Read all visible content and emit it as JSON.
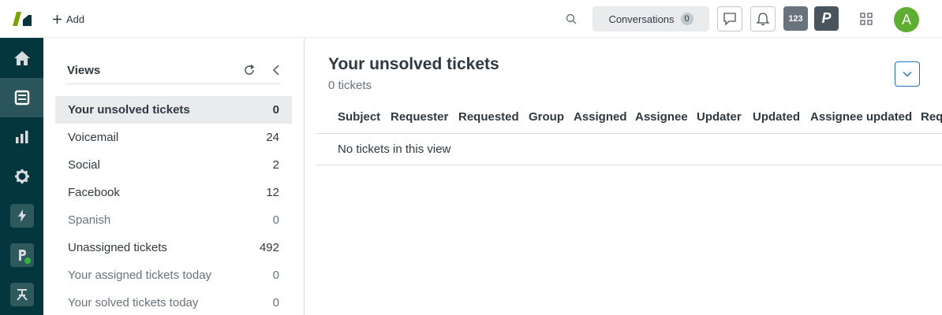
{
  "nav": {
    "items": [
      {
        "name": "home-icon",
        "active": false
      },
      {
        "name": "views-icon",
        "active": true
      },
      {
        "name": "reporting-icon",
        "active": false
      },
      {
        "name": "admin-gear-icon",
        "active": false
      },
      {
        "name": "lightning-icon",
        "active": false
      },
      {
        "name": "app-p-icon",
        "active": false
      },
      {
        "name": "app-figure-icon",
        "active": false
      }
    ]
  },
  "topbar": {
    "add_label": "Add",
    "conversations_label": "Conversations",
    "conversations_count": "0",
    "badge_123": "123",
    "badge_p": "P",
    "avatar_initial": "A"
  },
  "views": {
    "title": "Views",
    "items": [
      {
        "label": "Your unsolved tickets",
        "count": "0",
        "active": true,
        "muted": false
      },
      {
        "label": "Voicemail",
        "count": "24",
        "active": false,
        "muted": false
      },
      {
        "label": "Social",
        "count": "2",
        "active": false,
        "muted": false
      },
      {
        "label": "Facebook",
        "count": "12",
        "active": false,
        "muted": false
      },
      {
        "label": "Spanish",
        "count": "0",
        "active": false,
        "muted": true
      },
      {
        "label": "Unassigned tickets",
        "count": "492",
        "active": false,
        "muted": false
      },
      {
        "label": "Your assigned tickets today",
        "count": "0",
        "active": false,
        "muted": true
      },
      {
        "label": "Your solved tickets today",
        "count": "0",
        "active": false,
        "muted": true
      }
    ]
  },
  "main": {
    "title": "Your unsolved tickets",
    "subtitle": "0 tickets",
    "columns": [
      "Subject",
      "Requester",
      "Requested",
      "Group",
      "Assigned",
      "Assignee",
      "Updater",
      "Updated",
      "Assignee updated",
      "Req"
    ],
    "empty_message": "No tickets in this view"
  },
  "colors": {
    "nav_bg": "#03363d",
    "nav_active": "#2a565b",
    "avatar": "#5eae32",
    "badge_bg": "#68737d",
    "accent_blue": "#1f73b7"
  }
}
